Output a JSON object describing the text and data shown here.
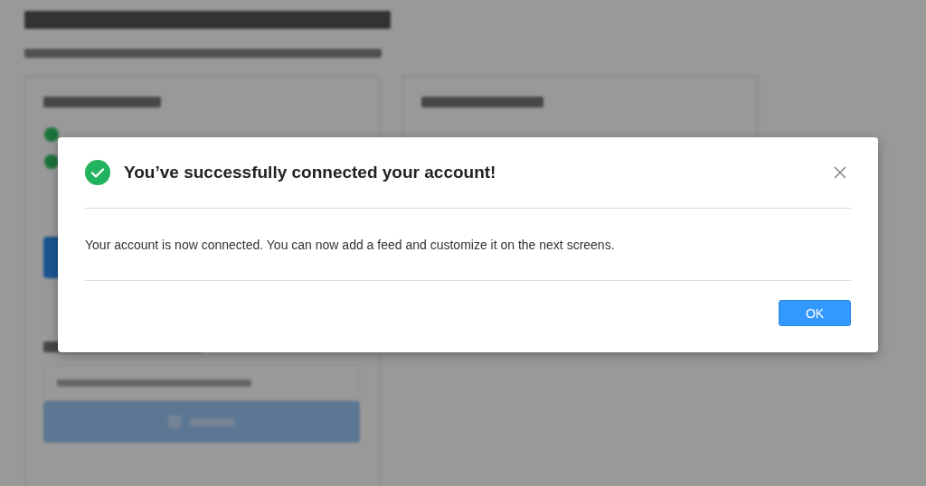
{
  "dialog": {
    "title": "You’ve successfully connected your account!",
    "message": "Your account is now connected. You can now add a feed and customize it on the next screens.",
    "button": "OK"
  }
}
